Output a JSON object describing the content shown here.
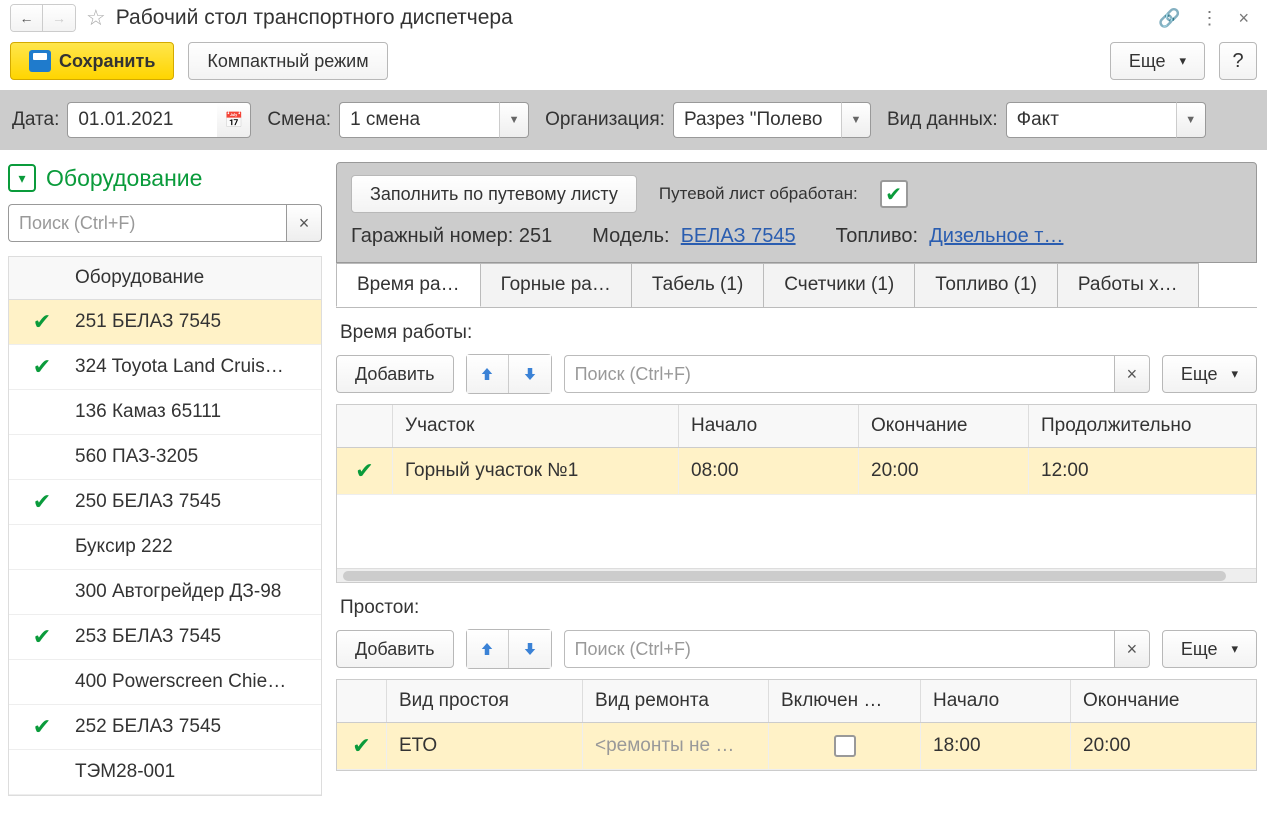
{
  "title": "Рабочий стол транспортного диспетчера",
  "toolbar": {
    "save": "Сохранить",
    "compact": "Компактный режим",
    "more": "Еще",
    "help": "?"
  },
  "filters": {
    "date_label": "Дата:",
    "date_value": "01.01.2021",
    "shift_label": "Смена:",
    "shift_value": "1 смена",
    "org_label": "Организация:",
    "org_value": "Разрез \"Полево",
    "datakind_label": "Вид данных:",
    "datakind_value": "Факт"
  },
  "equipment_panel": {
    "header": "Оборудование",
    "search_placeholder": "Поиск (Ctrl+F)",
    "col_header": "Оборудование",
    "rows": [
      {
        "checked": true,
        "name": "251 БЕЛАЗ 7545",
        "selected": true
      },
      {
        "checked": true,
        "name": "324 Toyota Land Cruis…"
      },
      {
        "checked": false,
        "name": "136 Камаз 65111"
      },
      {
        "checked": false,
        "name": "560 ПАЗ-3205"
      },
      {
        "checked": true,
        "name": "250 БЕЛАЗ 7545"
      },
      {
        "checked": false,
        "name": "Буксир 222"
      },
      {
        "checked": false,
        "name": "300 Автогрейдер ДЗ-98"
      },
      {
        "checked": true,
        "name": "253 БЕЛАЗ 7545"
      },
      {
        "checked": false,
        "name": "400 Powerscreen Chie…"
      },
      {
        "checked": true,
        "name": "252 БЕЛАЗ 7545"
      },
      {
        "checked": false,
        "name": "ТЭМ28-001"
      }
    ]
  },
  "form_header": {
    "fill_button": "Заполнить по путевому листу",
    "processed_label": "Путевой лист обработан:",
    "garage_label": "Гаражный номер:",
    "garage_value": "251",
    "model_label": "Модель:",
    "model_link": "БЕЛАЗ 7545",
    "fuel_label": "Топливо:",
    "fuel_link": "Дизельное т…"
  },
  "tabs": [
    "Время ра…",
    "Горные ра…",
    "Табель (1)",
    "Счетчики (1)",
    "Топливо (1)",
    "Работы х…"
  ],
  "worktime": {
    "section_label": "Время работы:",
    "add": "Добавить",
    "search_placeholder": "Поиск (Ctrl+F)",
    "more": "Еще",
    "columns": [
      "",
      "Участок",
      "Начало",
      "Окончание",
      "Продолжительно"
    ],
    "rows": [
      {
        "checked": true,
        "site": "Горный участок №1",
        "start": "08:00",
        "end": "20:00",
        "duration": "12:00"
      }
    ]
  },
  "downtime": {
    "section_label": "Простои:",
    "add": "Добавить",
    "search_placeholder": "Поиск (Ctrl+F)",
    "more": "Еще",
    "columns": [
      "",
      "Вид простоя",
      "Вид ремонта",
      "Включен …",
      "Начало",
      "Окончание"
    ],
    "rows": [
      {
        "checked": true,
        "kind": "ЕТО",
        "repair": "<ремонты не …",
        "included": false,
        "start": "18:00",
        "end": "20:00"
      }
    ]
  }
}
